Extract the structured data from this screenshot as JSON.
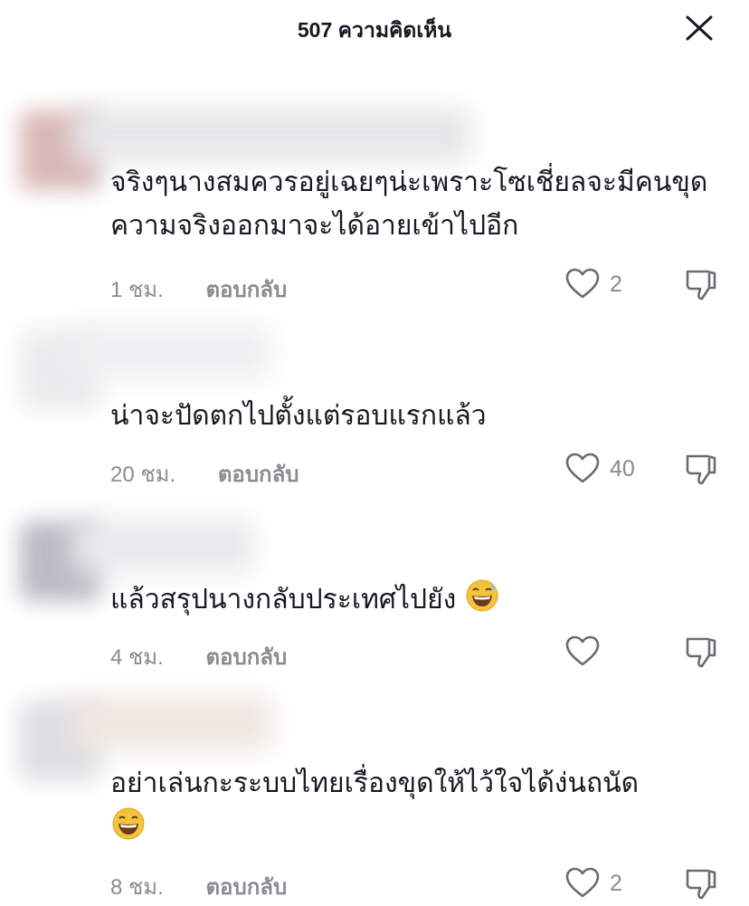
{
  "header": {
    "title": "507 ความคิดเห็น",
    "close_icon": "close-icon"
  },
  "comments": [
    {
      "text": "จริงๆนางสมควรอยู่เฉยๆน่ะเพราะโซเชี่ยลจะมีคนขุดความจริงออกมาจะได้อายเข้าไปอีก",
      "time": "1 ชม.",
      "reply": "ตอบกลับ",
      "likes": "2"
    },
    {
      "text": "น่าจะปัดตกไปตั้งแต่รอบแรกแล้ว",
      "time": "20 ชม.",
      "reply": "ตอบกลับ",
      "likes": "40"
    },
    {
      "text": "แล้วสรุปนางกลับประเทศไปยัง",
      "emoji": "grinning-sweat-emoji",
      "time": "4 ชม.",
      "reply": "ตอบกลับ",
      "likes": ""
    },
    {
      "text": "อย่าเล่นกะระบบไทยเรื่องขุดให้ไว้ใจได้ง่นถนัด",
      "emoji": "grinning-emoji",
      "time": "8 ชม.",
      "reply": "ตอบกลับ",
      "likes": "2"
    }
  ],
  "colors": {
    "text": "#161823",
    "muted": "#8a8b91",
    "background": "#ffffff"
  }
}
